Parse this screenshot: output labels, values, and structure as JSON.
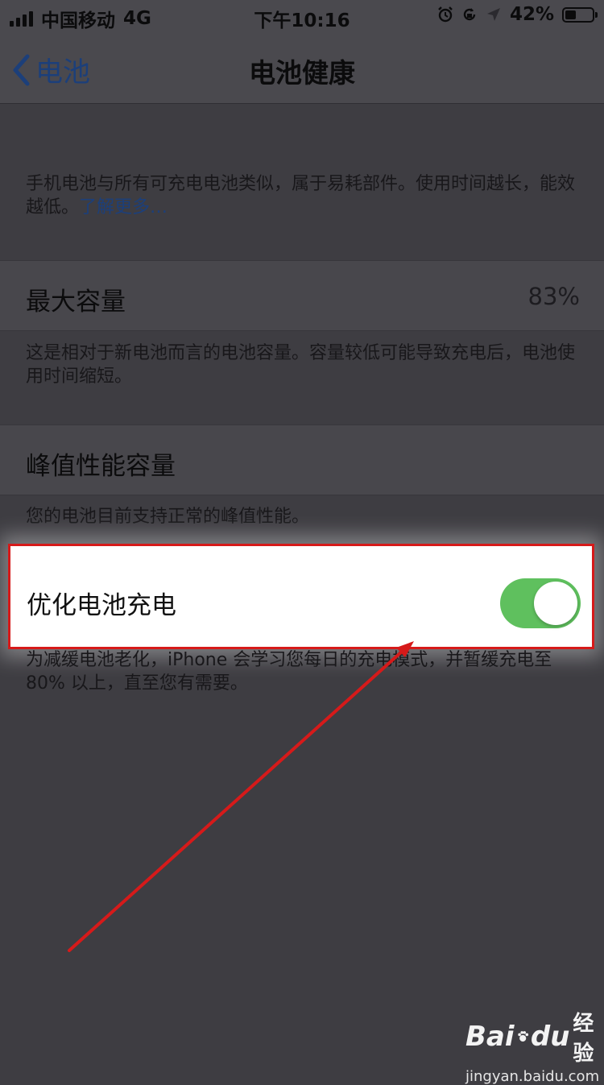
{
  "status_bar": {
    "carrier": "中国移动",
    "network": "4G",
    "time": "下午10:16",
    "battery_percent": "42%",
    "battery_level": 0.42,
    "icons": [
      "signal-icon",
      "alarm-icon",
      "rotation-lock-icon",
      "location-icon",
      "battery-icon"
    ]
  },
  "nav": {
    "back_label": "电池",
    "title": "电池健康"
  },
  "intro": {
    "text": "手机电池与所有可充电电池类似，属于易耗部件。使用时间越长，能效越低。",
    "link": "了解更多…"
  },
  "max_capacity": {
    "title": "最大容量",
    "value": "83%",
    "footnote": "这是相对于新电池而言的电池容量。容量较低可能导致充电后，电池使用时间缩短。"
  },
  "peak_performance": {
    "title": "峰值性能容量",
    "footnote": "您的电池目前支持正常的峰值性能。"
  },
  "optimized_charging": {
    "title": "优化电池充电",
    "enabled": true,
    "footnote": "为减缓电池老化，iPhone 会学习您每日的充电模式，并暂缓充电至 80% 以上，直至您有需要。"
  },
  "watermark": {
    "logo_left": "Bai",
    "logo_right": "du",
    "logo_cn": "经验",
    "url": "jingyan.baidu.com"
  },
  "colors": {
    "background": "#3e3d42",
    "link": "#1c3f7a",
    "toggle_on": "#5fc05e",
    "annotation_red": "#d61a1a"
  }
}
